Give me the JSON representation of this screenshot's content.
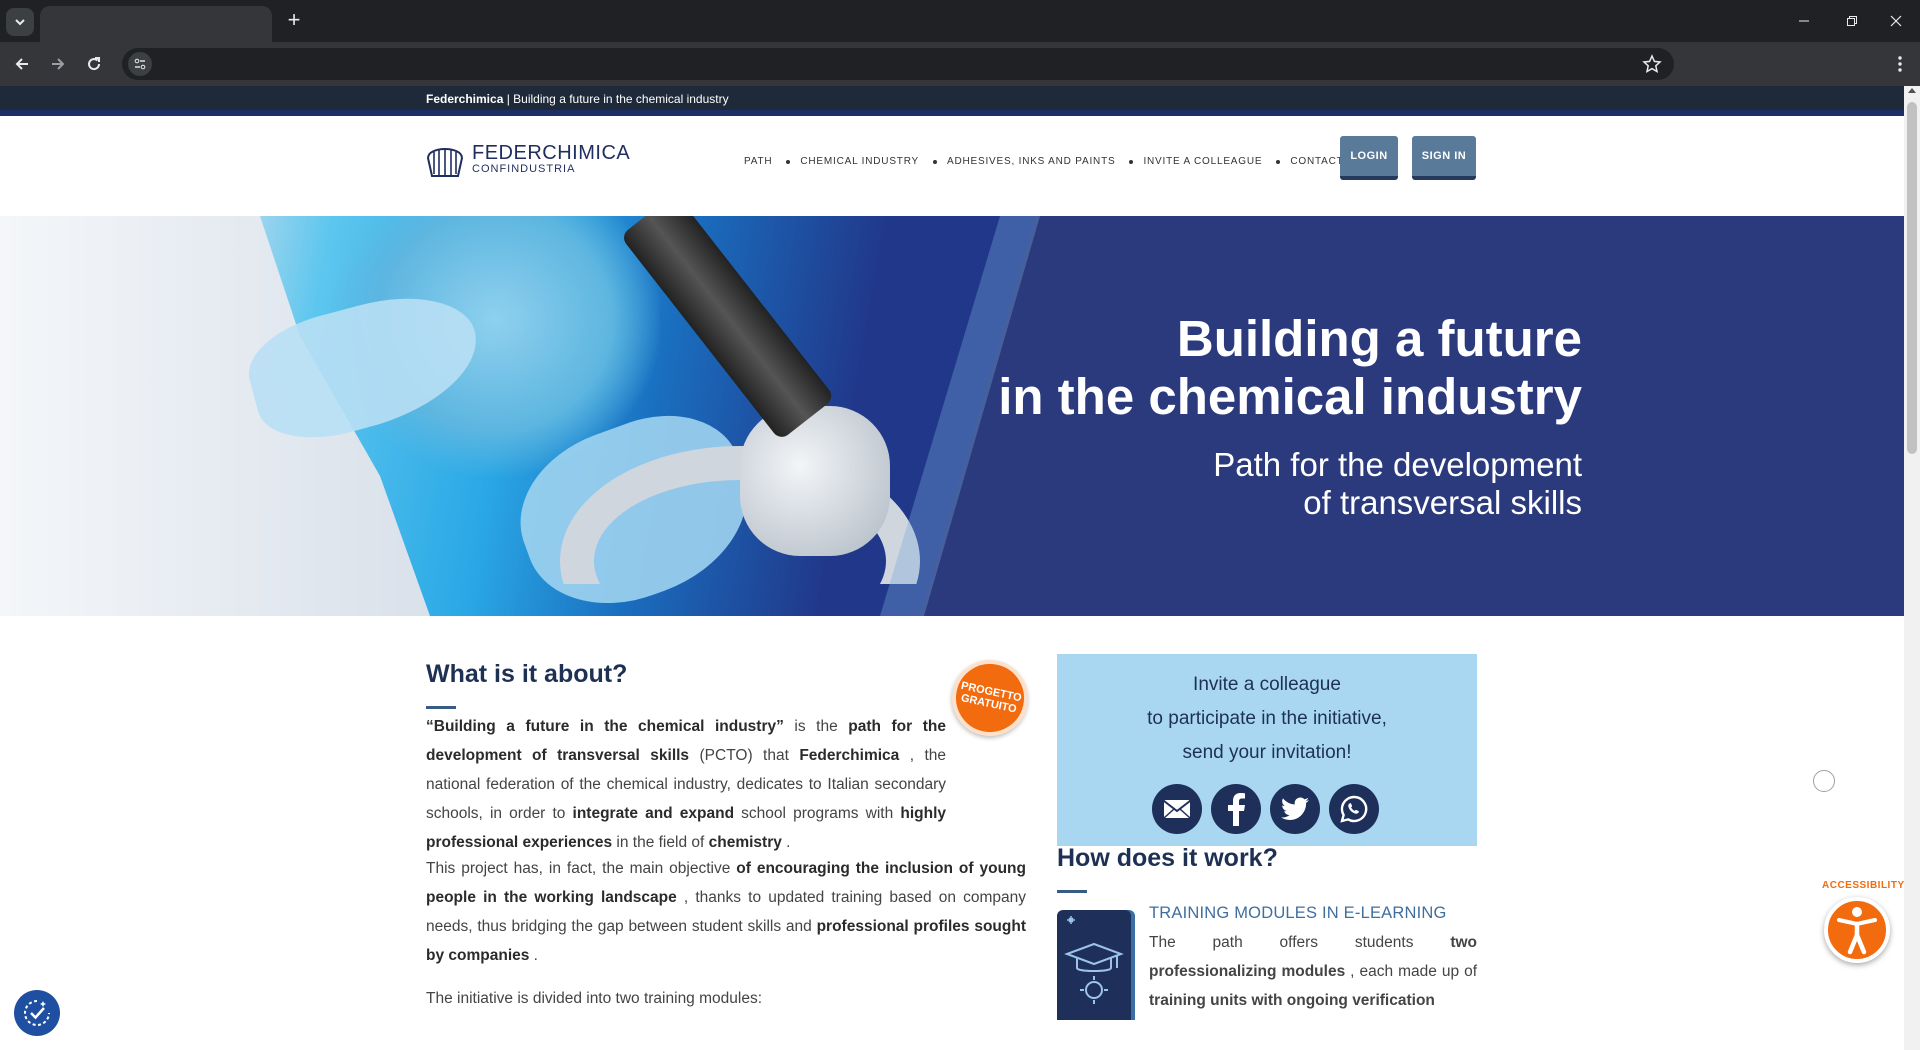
{
  "browser": {
    "new_tab_label": "+",
    "icons": [
      "tab-search-icon",
      "back-icon",
      "forward-icon",
      "reload-icon",
      "site-info-icon",
      "bookmark-star-icon",
      "menu-kebab-icon",
      "minimize-icon",
      "restore-icon",
      "close-icon"
    ]
  },
  "topstrip": {
    "brand": "Federchimica",
    "tagline": " | Building a future in the chemical industry"
  },
  "header": {
    "logo_line1": "FEDERCHIMICA",
    "logo_line2": "CONFINDUSTRIA",
    "menu": [
      "PATH",
      "CHEMICAL INDUSTRY",
      "ADHESIVES, INKS AND PAINTS",
      "INVITE A COLLEAGUE",
      "CONTACTS"
    ],
    "login_label": "LOGIN",
    "signin_label": "SIGN IN"
  },
  "hero": {
    "title_line1": "Building a future",
    "title_line2": "in the chemical industry",
    "sub_line1": "Path for the development",
    "sub_line2": "of transversal skills"
  },
  "about": {
    "title": "What is it about?",
    "badge_line1": "PROGETTO",
    "badge_line2": "GRATUITO",
    "p1": {
      "a": "“Building a future in the chemical industry”",
      "b": " is the ",
      "c": "path for the development of transversal skills",
      "d": " (PCTO) that ",
      "e": "Federchimica",
      "f": " , the national federation of the chemical industry, dedicates to Italian secondary schools, in order to ",
      "g": "integrate and expand",
      "h": " school programs with ",
      "i": "highly professional experiences",
      "j": " in the field of ",
      "k": "chemistry",
      "l": " ."
    },
    "p2": {
      "a": "This project has, in fact, the main objective ",
      "b": "of encouraging the inclusion of young people in the working landscape",
      "c": " , thanks to updated training based on company needs, thus bridging the gap between student skills and ",
      "d": "professional profiles sought by companies",
      "e": " ."
    },
    "p3": "The initiative is divided into two training modules:"
  },
  "invite": {
    "line1": "Invite a colleague",
    "line2": "to participate in the initiative,",
    "line3": "send your invitation!",
    "icons": [
      "email-icon",
      "facebook-icon",
      "twitter-icon",
      "whatsapp-icon"
    ]
  },
  "how": {
    "title": "How does it work?",
    "module_title": "TRAINING MODULES IN E-LEARNING",
    "module_text": {
      "a": "The path offers students ",
      "b": "two professionalizing modules",
      "c": " , each made up of ",
      "d": "training units with ongoing verification"
    }
  },
  "accessibility": {
    "label": "ACCESSIBILITY"
  },
  "colors": {
    "navy": "#1e3154",
    "accent_orange": "#f26b0f",
    "invite_bg": "#a9d7f2",
    "hero_bg": "#2b3a7d",
    "button_bg": "#5a7a9a"
  }
}
